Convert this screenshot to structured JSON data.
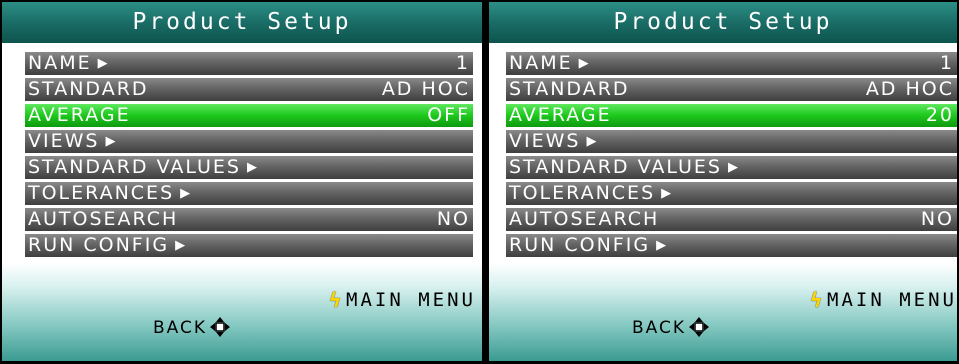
{
  "screens": [
    {
      "title": "Product Setup",
      "items": [
        {
          "label": "NAME",
          "value": "1",
          "selected": false
        },
        {
          "label": "STANDARD",
          "value": "AD HOC",
          "selected": false
        },
        {
          "label": "AVERAGE",
          "value": "OFF",
          "selected": true
        },
        {
          "label": "VIEWS",
          "value": "",
          "selected": false
        },
        {
          "label": "STANDARD VALUES",
          "value": "",
          "selected": false
        },
        {
          "label": "TOLERANCES",
          "value": "",
          "selected": false
        },
        {
          "label": "AUTOSEARCH",
          "value": "NO",
          "selected": false
        },
        {
          "label": "RUN CONFIG",
          "value": "",
          "selected": false
        }
      ],
      "main_menu_label": "MAIN MENU",
      "back_label": "BACK"
    },
    {
      "title": "Product Setup",
      "items": [
        {
          "label": "NAME",
          "value": "1",
          "selected": false
        },
        {
          "label": "STANDARD",
          "value": "AD HOC",
          "selected": false
        },
        {
          "label": "AVERAGE",
          "value": "20",
          "selected": true
        },
        {
          "label": "VIEWS",
          "value": "",
          "selected": false
        },
        {
          "label": "STANDARD VALUES",
          "value": "",
          "selected": false
        },
        {
          "label": "TOLERANCES",
          "value": "",
          "selected": false
        },
        {
          "label": "AUTOSEARCH",
          "value": "NO",
          "selected": false
        },
        {
          "label": "RUN CONFIG",
          "value": "",
          "selected": false
        }
      ],
      "main_menu_label": "MAIN MENU",
      "back_label": "BACK"
    }
  ],
  "icons": {
    "submenu_arrow": "arrow-right-icon",
    "main_menu": "lightning-bolt-icon",
    "back": "dpad-icon"
  },
  "colors": {
    "title_bar": "#1a6d66",
    "row": "#646464",
    "row_selected": "#1dc81d",
    "bolt": "#ffd400"
  }
}
